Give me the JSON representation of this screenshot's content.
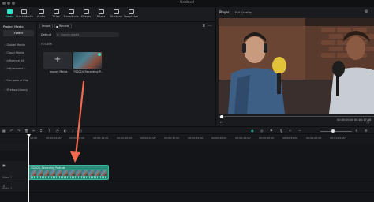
{
  "window": {
    "title": "Untitled"
  },
  "toolbar": {
    "items": [
      {
        "label": "Media",
        "icon": "media-icon",
        "active": true
      },
      {
        "label": "Stock Media",
        "icon": "stock-media-icon"
      },
      {
        "label": "Audio",
        "icon": "music-note-icon"
      },
      {
        "label": "Titles",
        "icon": "titles-icon"
      },
      {
        "label": "Transitions",
        "icon": "transitions-icon"
      },
      {
        "label": "Effects",
        "icon": "effects-icon"
      },
      {
        "label": "Filters",
        "icon": "filters-icon"
      },
      {
        "label": "Stickers",
        "icon": "stickers-icon"
      },
      {
        "label": "Templates",
        "icon": "templates-icon"
      }
    ]
  },
  "sidebar": {
    "header": "Project Media",
    "folder_button": "Folder",
    "items": [
      {
        "label": "Global Media"
      },
      {
        "label": "Cloud Media"
      },
      {
        "label": "Influence Kit"
      },
      {
        "label": "Adjustment L..."
      },
      {
        "label": "Compound Clip"
      },
      {
        "label": "Firebox Library"
      }
    ]
  },
  "media": {
    "import_label": "Import",
    "record_label": "Record",
    "default_label": "Default",
    "search_placeholder": "Search media",
    "folder_label": "FOLDER",
    "cards": [
      {
        "label": "Import Media"
      },
      {
        "label": "TS2024_Recording P..."
      }
    ]
  },
  "player": {
    "tab": "Player",
    "quality": "Full Quality",
    "current_time": "00:00:00:00",
    "total_time": "00:00:17:08",
    "progress": 0.0
  },
  "timeline": {
    "ruler_ticks": [
      "00:00",
      "00:00:05:00",
      "00:00:10:00",
      "00:00:15:00",
      "00:00:20:00",
      "00:00:25:00",
      "00:00:30:00",
      "00:00:35:00",
      "00:00:40:00",
      "00:00:45:00",
      "00:00:50:00",
      "00:00:55:00",
      "00:01:00:00",
      "00:01:05:00"
    ],
    "tracks": [
      {
        "name": "Video 1"
      },
      {
        "name": "Audio 1"
      }
    ],
    "clip": {
      "name": "TS2024_Recording_Podcast"
    },
    "zoom_level": 0.35
  },
  "colors": {
    "accent": "#2fe3c5",
    "clip_fill": "#2a8d7a",
    "annotation_arrow": "#f26a50"
  }
}
